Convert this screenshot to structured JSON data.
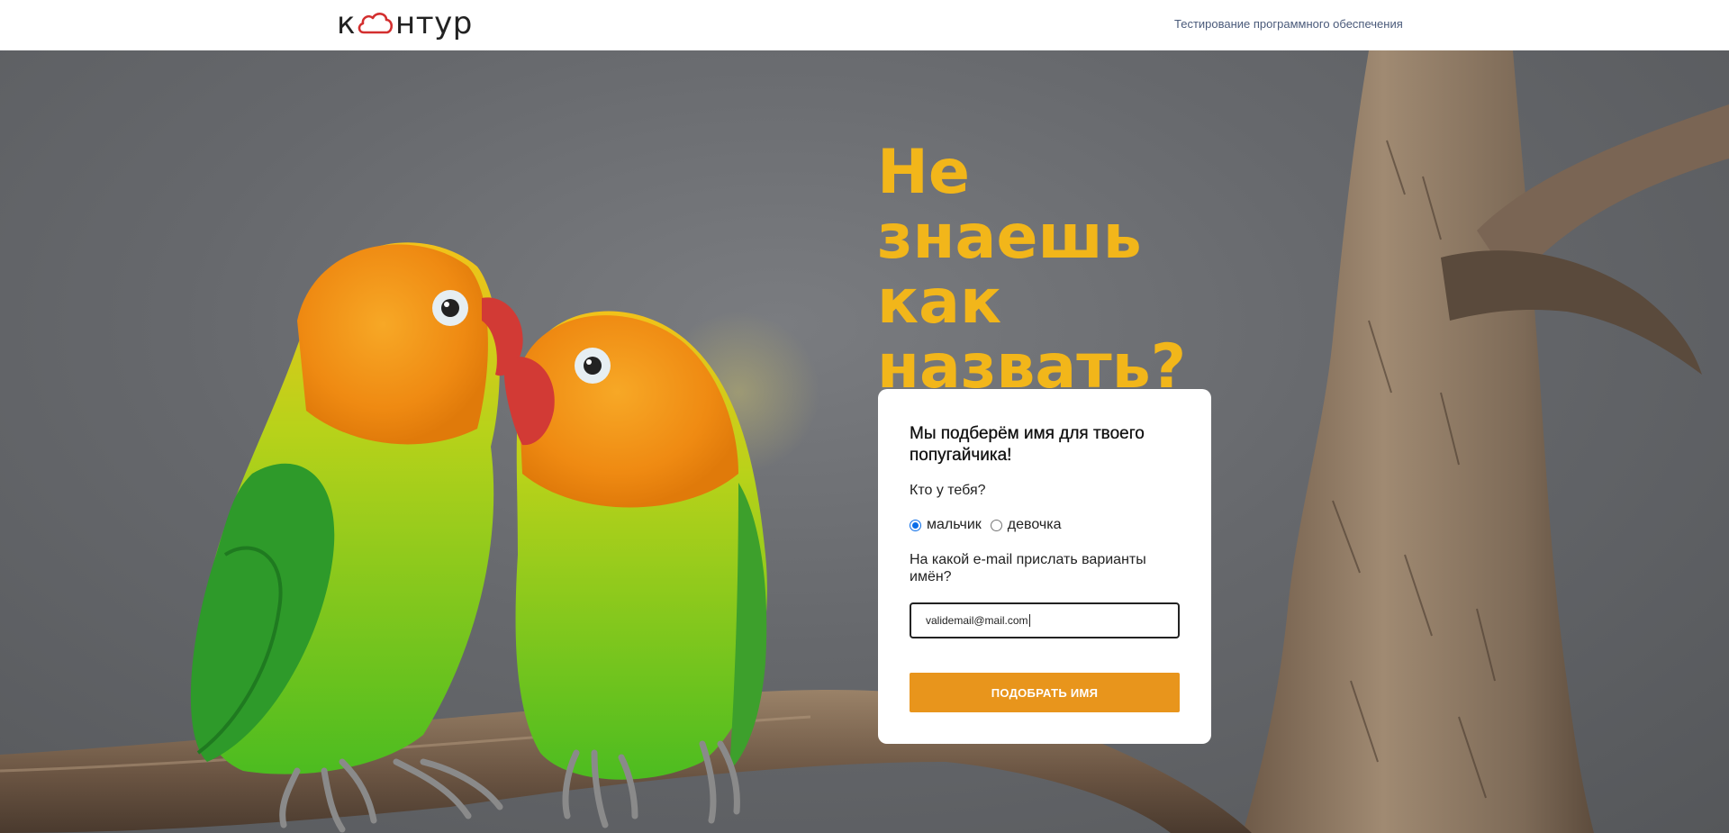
{
  "header": {
    "logo_text_left": "к",
    "logo_text_right": "нтур",
    "link_label": "Тестирование программного обеспечения"
  },
  "hero": {
    "headline": "Не\nзнаешь\nкак\nназвать?"
  },
  "form": {
    "title": "Мы подберём имя для твоего\nпопугайчика!",
    "gender_question": "Кто у тебя?",
    "gender_options": [
      {
        "label": "мальчик",
        "checked": true
      },
      {
        "label": "девочка",
        "checked": false
      }
    ],
    "email_question": "На какой e-mail прислать варианты\nимён?",
    "email_value": "validemail@mail.com",
    "submit_label": "ПОДОБРАТЬ ИМЯ"
  },
  "colors": {
    "headline": "#f2b61a",
    "button": "#e8951c",
    "logo_cloud": "#d32f2f",
    "radio_checked": "#0a6de8"
  },
  "icons": {
    "logo": "kontur-cloud-logo"
  }
}
